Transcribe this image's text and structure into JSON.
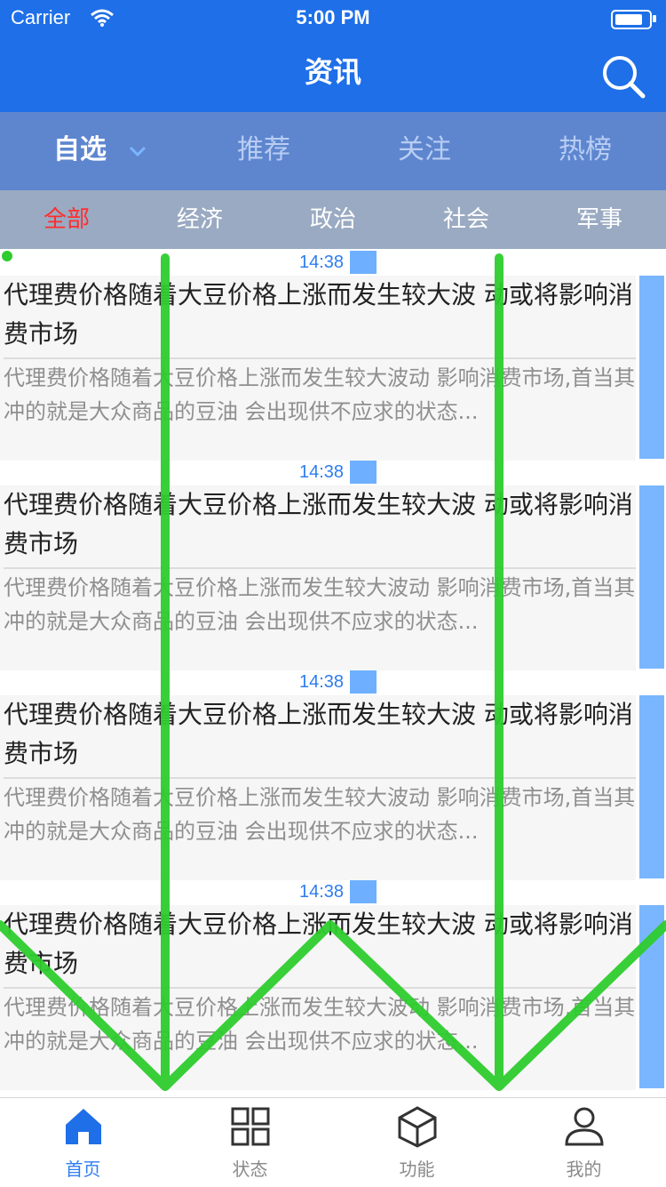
{
  "status_bar": {
    "carrier": "Carrier",
    "time": "5:00 PM"
  },
  "nav": {
    "title": "资讯",
    "search_icon": "search-icon"
  },
  "topics": [
    {
      "label": "自选",
      "active": true
    },
    {
      "label": "推荐",
      "active": false
    },
    {
      "label": "关注",
      "active": false
    },
    {
      "label": "热榜",
      "active": false
    }
  ],
  "categories": [
    {
      "label": "全部",
      "active": true
    },
    {
      "label": "经济",
      "active": false
    },
    {
      "label": "政治",
      "active": false
    },
    {
      "label": "社会",
      "active": false
    },
    {
      "label": "军事",
      "active": false
    }
  ],
  "news": [
    {
      "time": "14:38",
      "headline": "代理费价格随着大豆价格上涨而发生较大波 动或将影响消费市场",
      "summary": "代理费价格随着大豆价格上涨而发生较大波动 影响消费市场,首当其冲的就是大众商品的豆油 会出现供不应求的状态..."
    },
    {
      "time": "14:38",
      "headline": "代理费价格随着大豆价格上涨而发生较大波 动或将影响消费市场",
      "summary": "代理费价格随着大豆价格上涨而发生较大波动 影响消费市场,首当其冲的就是大众商品的豆油 会出现供不应求的状态..."
    },
    {
      "time": "14:38",
      "headline": "代理费价格随着大豆价格上涨而发生较大波 动或将影响消费市场",
      "summary": "代理费价格随着大豆价格上涨而发生较大波动 影响消费市场,首当其冲的就是大众商品的豆油 会出现供不应求的状态..."
    },
    {
      "time": "14:38",
      "headline": "代理费价格随着大豆价格上涨而发生较大波 动或将影响消费市场",
      "summary": "代理费价格随着大豆价格上涨而发生较大波动 影响消费市场,首当其冲的就是大众商品的豆油 会出现供不应求的状态..."
    }
  ],
  "tabbar": [
    {
      "label": "首页",
      "icon": "home-icon",
      "active": true
    },
    {
      "label": "状态",
      "icon": "grid-icon",
      "active": false
    },
    {
      "label": "功能",
      "icon": "cube-icon",
      "active": false
    },
    {
      "label": "我的",
      "icon": "user-icon",
      "active": false
    }
  ],
  "colors": {
    "brand": "#1e6fe8",
    "accent_red": "#ff2d2d",
    "gesture_green": "#2ecc2e"
  }
}
